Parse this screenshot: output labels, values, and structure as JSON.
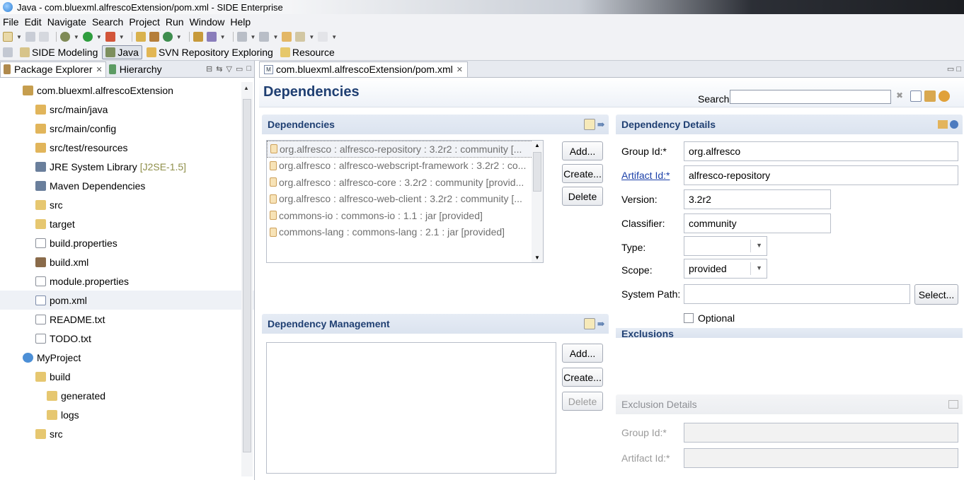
{
  "window": {
    "title": "Java - com.bluexml.alfrescoExtension/pom.xml - SIDE Enterprise"
  },
  "menu": [
    "File",
    "Edit",
    "Navigate",
    "Search",
    "Project",
    "Run",
    "Window",
    "Help"
  ],
  "perspectives": [
    {
      "label": "SIDE Modeling",
      "active": false
    },
    {
      "label": "Java",
      "active": true
    },
    {
      "label": "SVN Repository Exploring",
      "active": false
    },
    {
      "label": "Resource",
      "active": false
    }
  ],
  "left_panel": {
    "tabs": [
      {
        "label": "Package Explorer"
      },
      {
        "label": "Hierarchy"
      }
    ],
    "tree": [
      {
        "label": "com.bluexml.alfrescoExtension"
      },
      {
        "label": "src/main/java"
      },
      {
        "label": "src/main/config"
      },
      {
        "label": "src/test/resources"
      },
      {
        "label": "JRE System Library",
        "decoration": "[J2SE-1.5]"
      },
      {
        "label": "Maven Dependencies"
      },
      {
        "label": "src"
      },
      {
        "label": "target"
      },
      {
        "label": "build.properties"
      },
      {
        "label": "build.xml"
      },
      {
        "label": "module.properties"
      },
      {
        "label": "pom.xml"
      },
      {
        "label": "README.txt"
      },
      {
        "label": "TODO.txt"
      },
      {
        "label": "MyProject"
      },
      {
        "label": "build"
      },
      {
        "label": "generated"
      },
      {
        "label": "logs"
      },
      {
        "label": "src"
      }
    ]
  },
  "editor": {
    "tab_label": "com.bluexml.alfrescoExtension/pom.xml",
    "form_title": "Dependencies",
    "search_label": "Search:",
    "search_value": "",
    "dependencies": {
      "title": "Dependencies",
      "items": [
        "org.alfresco : alfresco-repository : 3.2r2 : community [...",
        "org.alfresco : alfresco-webscript-framework : 3.2r2 : co...",
        "org.alfresco : alfresco-core : 3.2r2 : community [provid...",
        "org.alfresco : alfresco-web-client : 3.2r2 : community [...",
        "commons-io : commons-io : 1.1 : jar [provided]",
        "commons-lang : commons-lang : 2.1 : jar [provided]"
      ],
      "buttons": {
        "add": "Add...",
        "create": "Create...",
        "delete": "Delete"
      }
    },
    "dependency_management": {
      "title": "Dependency Management",
      "items": [],
      "buttons": {
        "add": "Add...",
        "create": "Create...",
        "delete": "Delete"
      }
    },
    "details": {
      "title": "Dependency Details",
      "group_id_label": "Group Id:*",
      "group_id": "org.alfresco",
      "artifact_id_label": "Artifact Id:*",
      "artifact_id": "alfresco-repository",
      "version_label": "Version:",
      "version": "3.2r2",
      "classifier_label": "Classifier:",
      "classifier": "community",
      "type_label": "Type:",
      "type": "",
      "scope_label": "Scope:",
      "scope": "provided",
      "system_path_label": "System Path:",
      "system_path": "",
      "select_button": "Select...",
      "optional_label": "Optional",
      "optional_checked": false,
      "exclusions_partial": "Exclusions"
    },
    "exclusion_details": {
      "title": "Exclusion Details",
      "group_id_label": "Group Id:*",
      "group_id": "",
      "artifact_id_label": "Artifact Id:*",
      "artifact_id": ""
    }
  },
  "colors": {
    "section_title": "#1f3f72",
    "link": "#1a3fa8",
    "header_bg": "#dbe3ef"
  }
}
